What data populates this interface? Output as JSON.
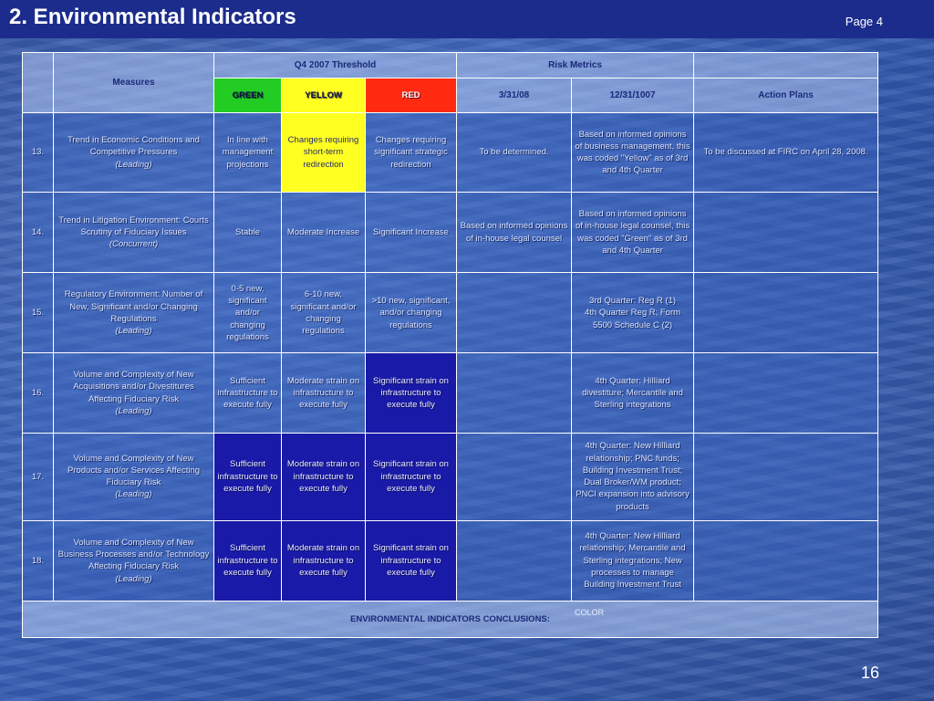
{
  "header": {
    "title": "2. Environmental Indicators",
    "page": "Page 4",
    "slide_number": "16"
  },
  "columns": {
    "measures": "Measures",
    "threshold": "Q4 2007 Threshold",
    "risk_metrics": "Risk Metrics",
    "green": "GREEN",
    "yellow": "YELLOW",
    "red": "RED",
    "date1": "3/31/08",
    "date2": "12/31/1007",
    "action_plans": "Action Plans"
  },
  "rows": [
    {
      "num": "13.",
      "measure": "Trend in Economic Conditions and Competitive Pressures",
      "tag": "(Leading)",
      "green": "In line with management projections",
      "yellow": "Changes requiring short-term redirection",
      "red": "Changes requiring significant strategic redirection",
      "m1": "To be determined.",
      "m2": "Based on informed opinions of business management, this was coded \"Yellow\" as of 3rd and 4th Quarter",
      "action": "To be discussed at FIRC on April 28, 2008."
    },
    {
      "num": "14.",
      "measure": "Trend in Litigation Environment: Courts Scrutiny of Fiduciary Issues",
      "tag": "(Concurrent)",
      "green": "Stable",
      "yellow": "Moderate Increase",
      "red": "Significant Increase",
      "m1": "Based on informed opinions of in-house legal counsel",
      "m2": "Based on informed opinions of in-house legal counsel, this was coded \"Green\" as of 3rd and 4th Quarter",
      "action": ""
    },
    {
      "num": "15.",
      "measure": "Regulatory Environment: Number of New, Significant and/or Changing Regulations",
      "tag": "(Leading)",
      "green": "0-5 new, significant and/or changing regulations",
      "yellow": "6-10 new, significant and/or changing regulations",
      "red": ">10 new, significant, and/or changing regulations",
      "m1": "",
      "m2": "3rd Quarter: Reg R (1)\n4th Quarter Reg R; Form 5500 Schedule C (2)",
      "action": ""
    },
    {
      "num": "16.",
      "measure": "Volume and Complexity of New Acquisitions and/or Divestitures Affecting Fiduciary Risk",
      "tag": "(Leading)",
      "green": "Sufficient infrastructure to execute fully",
      "yellow": "Moderate strain on infrastructure to execute fully",
      "red": "Significant strain on infrastructure to execute fully",
      "m1": "",
      "m2": "4th Quarter: Hilliard divestiture; Mercantile and Sterling integrations",
      "action": ""
    },
    {
      "num": "17.",
      "measure": "Volume and Complexity of New Products and/or Services Affecting Fiduciary Risk",
      "tag": "(Leading)",
      "green": "Sufficient infrastructure to execute fully",
      "yellow": "Moderate strain on infrastructure to execute fully",
      "red": "Significant strain on infrastructure to execute fully",
      "m1": "",
      "m2": "4th Quarter: New Hilliard relationship; PNC funds; Building Investment Trust; Dual Broker/WM product; PNCI expansion into advisory products",
      "action": ""
    },
    {
      "num": "18.",
      "measure": "Volume and Complexity of New Business Processes and/or Technology Affecting Fiduciary Risk",
      "tag": "(Leading)",
      "green": "Sufficient infrastructure to execute fully",
      "yellow": "Moderate strain on infrastructure to execute fully",
      "red": "Significant strain on infrastructure to execute fully",
      "m1": "",
      "m2": "4th Quarter: New Hilliard relationship; Mercantile and Sterling integrations; New processes to manage Building Investment Trust",
      "action": ""
    }
  ],
  "conclusions": {
    "label": "ENVIRONMENTAL INDICATORS CONCLUSIONS:",
    "color_label": "COLOR"
  }
}
